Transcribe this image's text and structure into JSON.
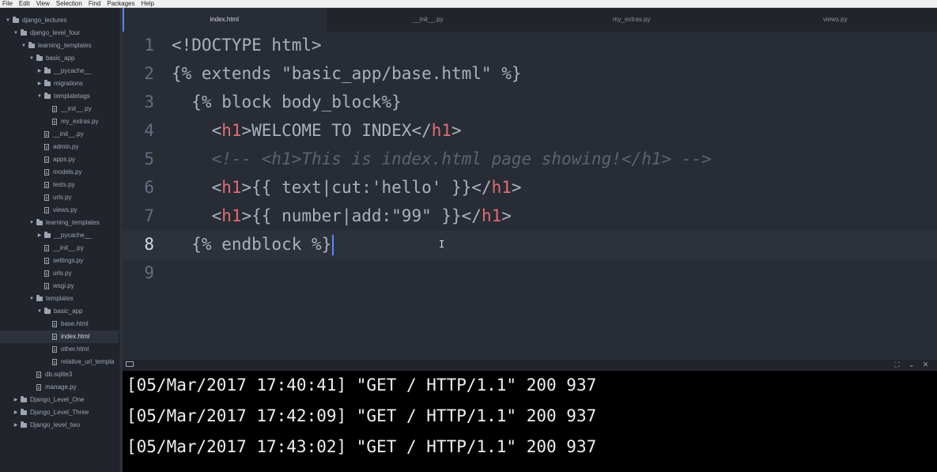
{
  "menu": [
    "File",
    "Edit",
    "View",
    "Selection",
    "Find",
    "Packages",
    "Help"
  ],
  "sidebar": {
    "items": [
      {
        "label": "django_lectures",
        "type": "folder",
        "open": true,
        "depth": 0
      },
      {
        "label": "django_level_four",
        "type": "folder",
        "open": true,
        "depth": 1
      },
      {
        "label": "learning_templates",
        "type": "folder",
        "open": true,
        "depth": 2
      },
      {
        "label": "basic_app",
        "type": "folder",
        "open": true,
        "depth": 3
      },
      {
        "label": "__pycache__",
        "type": "folder",
        "open": false,
        "depth": 4
      },
      {
        "label": "migrations",
        "type": "folder",
        "open": false,
        "depth": 4
      },
      {
        "label": "templatetags",
        "type": "folder",
        "open": true,
        "depth": 4
      },
      {
        "label": "__init__.py",
        "type": "file",
        "depth": 5
      },
      {
        "label": "my_extras.py",
        "type": "file",
        "depth": 5
      },
      {
        "label": "__init__.py",
        "type": "file",
        "depth": 4
      },
      {
        "label": "admin.py",
        "type": "file",
        "depth": 4
      },
      {
        "label": "apps.py",
        "type": "file",
        "depth": 4
      },
      {
        "label": "models.py",
        "type": "file",
        "depth": 4
      },
      {
        "label": "tests.py",
        "type": "file",
        "depth": 4
      },
      {
        "label": "urls.py",
        "type": "file",
        "depth": 4
      },
      {
        "label": "views.py",
        "type": "file",
        "depth": 4
      },
      {
        "label": "learning_templates",
        "type": "folder",
        "open": true,
        "depth": 3
      },
      {
        "label": "__pycache__",
        "type": "folder",
        "open": false,
        "depth": 4
      },
      {
        "label": "__init__.py",
        "type": "file",
        "depth": 4
      },
      {
        "label": "settings.py",
        "type": "file",
        "depth": 4
      },
      {
        "label": "urls.py",
        "type": "file",
        "depth": 4
      },
      {
        "label": "wsgi.py",
        "type": "file",
        "depth": 4
      },
      {
        "label": "templates",
        "type": "folder",
        "open": true,
        "depth": 3
      },
      {
        "label": "basic_app",
        "type": "folder",
        "open": true,
        "depth": 4
      },
      {
        "label": "base.html",
        "type": "file",
        "depth": 5
      },
      {
        "label": "index.html",
        "type": "file",
        "depth": 5,
        "selected": true
      },
      {
        "label": "other.html",
        "type": "file",
        "depth": 5
      },
      {
        "label": "relative_url_templa",
        "type": "file",
        "depth": 5
      },
      {
        "label": "db.sqlite3",
        "type": "file",
        "depth": 3
      },
      {
        "label": "manage.py",
        "type": "file",
        "depth": 3
      },
      {
        "label": "Django_Level_One",
        "type": "folder",
        "open": false,
        "depth": 1
      },
      {
        "label": "Django_Level_Three",
        "type": "folder",
        "open": false,
        "depth": 1
      },
      {
        "label": "Django_level_two",
        "type": "folder",
        "open": false,
        "depth": 1
      }
    ]
  },
  "tabs": [
    {
      "label": "index.html",
      "active": true
    },
    {
      "label": "__init__.py",
      "active": false
    },
    {
      "label": "my_extras.py",
      "active": false
    },
    {
      "label": "views.py",
      "active": false
    }
  ],
  "editor": {
    "lines": [
      {
        "n": "1",
        "parts": [
          {
            "t": "<!DOCTYPE html>",
            "c": "plain"
          }
        ]
      },
      {
        "n": "2",
        "parts": [
          {
            "t": "{% extends \"basic_app/base.html\" %}",
            "c": "plain"
          }
        ]
      },
      {
        "n": "3",
        "parts": [
          {
            "t": "  {% block body_block%}",
            "c": "plain"
          }
        ]
      },
      {
        "n": "4",
        "parts": [
          {
            "t": "    <",
            "c": "plain"
          },
          {
            "t": "h1",
            "c": "tag"
          },
          {
            "t": ">WELCOME TO INDEX</",
            "c": "plain"
          },
          {
            "t": "h1",
            "c": "tag"
          },
          {
            "t": ">",
            "c": "plain"
          }
        ]
      },
      {
        "n": "5",
        "parts": [
          {
            "t": "    <!-- <h1>This is index.html page showing!</h1> -->",
            "c": "comment"
          }
        ]
      },
      {
        "n": "6",
        "parts": [
          {
            "t": "    <",
            "c": "plain"
          },
          {
            "t": "h1",
            "c": "tag"
          },
          {
            "t": ">{{ text|cut:'hello' }}</",
            "c": "plain"
          },
          {
            "t": "h1",
            "c": "tag"
          },
          {
            "t": ">",
            "c": "plain"
          }
        ]
      },
      {
        "n": "7",
        "parts": [
          {
            "t": "    <",
            "c": "plain"
          },
          {
            "t": "h1",
            "c": "tag"
          },
          {
            "t": ">{{ number|add:\"99\" }}</",
            "c": "plain"
          },
          {
            "t": "h1",
            "c": "tag"
          },
          {
            "t": ">",
            "c": "plain"
          }
        ]
      },
      {
        "n": "8",
        "parts": [
          {
            "t": "  {% endblock %}",
            "c": "plain"
          }
        ],
        "cursor": true
      },
      {
        "n": "9",
        "parts": [
          {
            "t": "",
            "c": "plain"
          }
        ]
      }
    ]
  },
  "terminal": {
    "lines": [
      "[05/Mar/2017 17:40:41] \"GET / HTTP/1.1\" 200 937",
      "[05/Mar/2017 17:42:09] \"GET / HTTP/1.1\" 200 937",
      "[05/Mar/2017 17:43:02] \"GET / HTTP/1.1\" 200 937"
    ]
  },
  "icons": {
    "terminal_left": "terminal-icon",
    "maximize": "maximize-icon",
    "collapse": "chevron-down-icon",
    "close": "close-icon"
  }
}
